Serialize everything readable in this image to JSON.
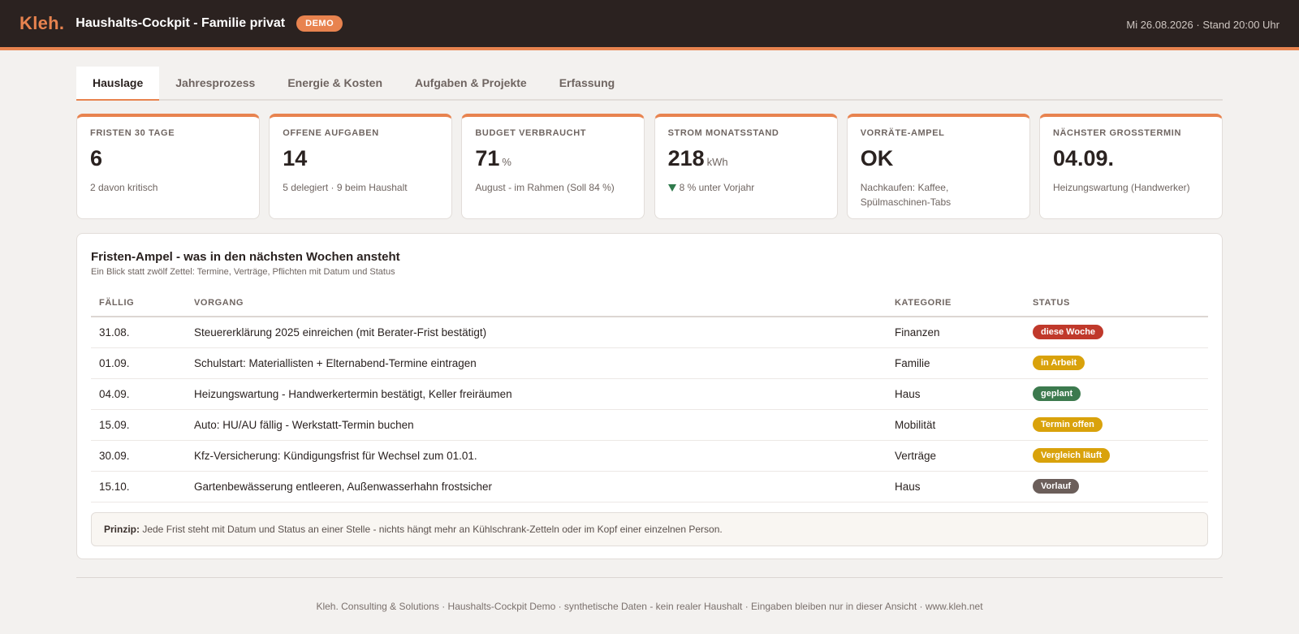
{
  "header": {
    "logo": "Kleh.",
    "title": "Haushalts-Cockpit - Familie privat",
    "badge": "DEMO",
    "date": "Mi 26.08.2026 · Stand 20:00 Uhr"
  },
  "tabs": [
    {
      "label": "Hauslage",
      "active": true
    },
    {
      "label": "Jahresprozess",
      "active": false
    },
    {
      "label": "Energie & Kosten",
      "active": false
    },
    {
      "label": "Aufgaben & Projekte",
      "active": false
    },
    {
      "label": "Erfassung",
      "active": false
    }
  ],
  "kpis": [
    {
      "label": "FRISTEN 30 TAGE",
      "value": "6",
      "unit": "",
      "sub": "2 davon kritisch"
    },
    {
      "label": "OFFENE AUFGABEN",
      "value": "14",
      "unit": "",
      "sub": "5 delegiert · 9 beim Haushalt"
    },
    {
      "label": "BUDGET VERBRAUCHT",
      "value": "71",
      "unit": "%",
      "sub": "August - im Rahmen (Soll 84 %)"
    },
    {
      "label": "STROM MONATSSTAND",
      "value": "218",
      "unit": "kWh",
      "sub": "8 % unter Vorjahr",
      "trend_icon": "triangle-down-icon"
    },
    {
      "label": "VORRÄTE-AMPEL",
      "value": "OK",
      "unit": "",
      "sub": "Nachkaufen: Kaffee, Spülmaschinen-Tabs"
    },
    {
      "label": "NÄCHSTER GROSSTERMIN",
      "value": "04.09.",
      "unit": "",
      "sub": "Heizungswartung (Handwerker)"
    }
  ],
  "panel": {
    "title": "Fristen-Ampel - was in den nächsten Wochen ansteht",
    "subtitle": "Ein Blick statt zwölf Zettel: Termine, Verträge, Pflichten mit Datum und Status",
    "columns": {
      "due": "FÄLLIG",
      "task": "VORGANG",
      "category": "KATEGORIE",
      "status": "STATUS"
    },
    "rows": [
      {
        "due": "31.08.",
        "task": "Steuererklärung 2025 einreichen (mit Berater-Frist bestätigt)",
        "category": "Finanzen",
        "status": "diese Woche",
        "status_color": "#c0392b"
      },
      {
        "due": "01.09.",
        "task": "Schulstart: Materiallisten + Elternabend-Termine eintragen",
        "category": "Familie",
        "status": "in Arbeit",
        "status_color": "#d9a20b"
      },
      {
        "due": "04.09.",
        "task": "Heizungswartung - Handwerkertermin bestätigt, Keller freiräumen",
        "category": "Haus",
        "status": "geplant",
        "status_color": "#3c7a4e"
      },
      {
        "due": "15.09.",
        "task": "Auto: HU/AU fällig - Werkstatt-Termin buchen",
        "category": "Mobilität",
        "status": "Termin offen",
        "status_color": "#d9a20b"
      },
      {
        "due": "30.09.",
        "task": "Kfz-Versicherung: Kündigungsfrist für Wechsel zum 01.01.",
        "category": "Verträge",
        "status": "Vergleich läuft",
        "status_color": "#d9a20b"
      },
      {
        "due": "15.10.",
        "task": "Gartenbewässerung entleeren, Außenwasserhahn frostsicher",
        "category": "Haus",
        "status": "Vorlauf",
        "status_color": "#6b5e5a"
      }
    ],
    "note_label": "Prinzip:",
    "note_text": " Jede Frist steht mit Datum und Status an einer Stelle - nichts hängt mehr an Kühlschrank-Zetteln oder im Kopf einer einzelnen Person."
  },
  "footer": "Kleh. Consulting & Solutions · Haushalts-Cockpit Demo · synthetische Daten - kein realer Haushalt · Eingaben bleiben nur in dieser Ansicht · www.kleh.net"
}
